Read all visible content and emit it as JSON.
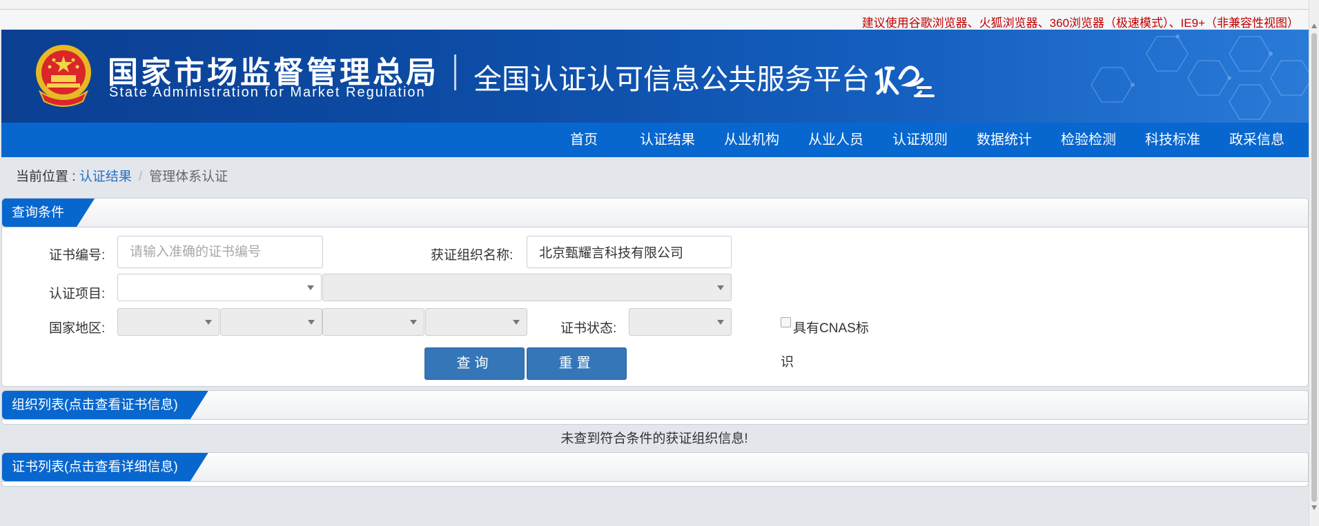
{
  "notice": "建议使用谷歌浏览器、火狐浏览器、360浏览器（极速模式）、IE9+（非兼容性视图）",
  "header": {
    "brand_cn": "国家市场监督管理总局",
    "brand_en": "State Administration  for  Market Regulation",
    "platform": "全国认证认可信息公共服务平台",
    "logo_text": "认云"
  },
  "nav": {
    "items": [
      "首页",
      "认证结果",
      "从业机构",
      "从业人员",
      "认证规则",
      "数据统计",
      "检验检测",
      "科技标准",
      "政采信息"
    ]
  },
  "breadcrumb": {
    "prefix": "当前位置 : ",
    "link": "认证结果",
    "separator": "/",
    "current": "管理体系认证"
  },
  "query_panel": {
    "title": "查询条件",
    "cert_no_label": "证书编号:",
    "cert_no_placeholder": "请输入准确的证书编号",
    "cert_no_value": "",
    "org_name_label": "获证组织名称:",
    "org_name_value": "北京甄耀言科技有限公司",
    "project_label": "认证项目:",
    "region_label": "国家地区:",
    "status_label": "证书状态:",
    "cnas_label_1": "具有CNAS标",
    "cnas_label_2": "识",
    "search_button": "查询",
    "reset_button": "重置"
  },
  "org_panel": {
    "title": "组织列表(点击查看证书信息)",
    "empty_message": "未查到符合条件的获证组织信息!"
  },
  "cert_panel": {
    "title": "证书列表(点击查看详细信息)"
  },
  "colors": {
    "nav_blue": "#0767cf",
    "header_blue": "#0d4ea8",
    "button_blue": "#3476b8",
    "notice_red": "#c00000",
    "page_bg": "#e3e7ec"
  }
}
